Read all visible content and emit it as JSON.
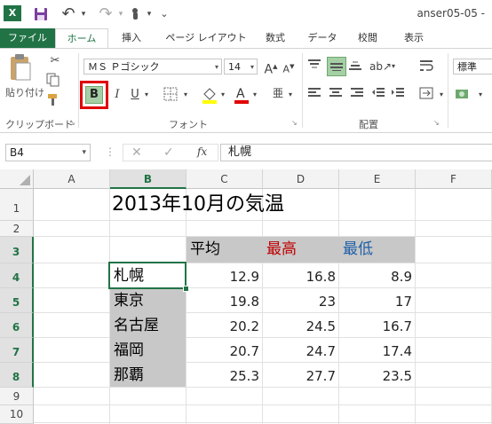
{
  "window": {
    "title": "anser05-05 -"
  },
  "quick_access": {
    "app_icon": "X",
    "save_icon": "save-icon",
    "undo": "↶",
    "redo": "↷",
    "touch": "touch-mode-icon",
    "more": "⌄"
  },
  "tabs": [
    "ファイル",
    "ホーム",
    "挿入",
    "ページ レイアウト",
    "数式",
    "データ",
    "校閲",
    "表示"
  ],
  "ribbon": {
    "clipboard": {
      "paste_label": "貼り付け",
      "group_label": "クリップボード"
    },
    "font": {
      "font_name": "ＭＳ Ｐゴシック",
      "font_size": "14",
      "bold": "B",
      "italic": "I",
      "underline": "U",
      "group_label": "フォント",
      "grow": "A",
      "shrink": "A",
      "ruby": "亜"
    },
    "alignment": {
      "group_label": "配置"
    },
    "number": {
      "format": "標準"
    }
  },
  "formula_bar": {
    "name_box": "B4",
    "fx": "fx",
    "value": "札幌"
  },
  "columns": [
    "A",
    "B",
    "C",
    "D",
    "E",
    "F"
  ],
  "rows": [
    "1",
    "2",
    "3",
    "4",
    "5",
    "6",
    "7",
    "8",
    "9",
    "10"
  ],
  "sheet": {
    "title": "2013年10月の気温",
    "headers": [
      "平均",
      "最高",
      "最低"
    ],
    "cities": [
      "札幌",
      "東京",
      "名古屋",
      "福岡",
      "那覇"
    ],
    "avg": [
      "12.9",
      "19.8",
      "20.2",
      "20.7",
      "25.3"
    ],
    "high": [
      "16.8",
      "23",
      "24.5",
      "24.7",
      "27.7"
    ],
    "low": [
      "8.9",
      "17",
      "16.7",
      "17.4",
      "23.5"
    ]
  },
  "colors": {
    "accent": "#217346",
    "high_header": "#c00000",
    "low_header": "#1f5fa8",
    "highlight": "#e00000"
  }
}
